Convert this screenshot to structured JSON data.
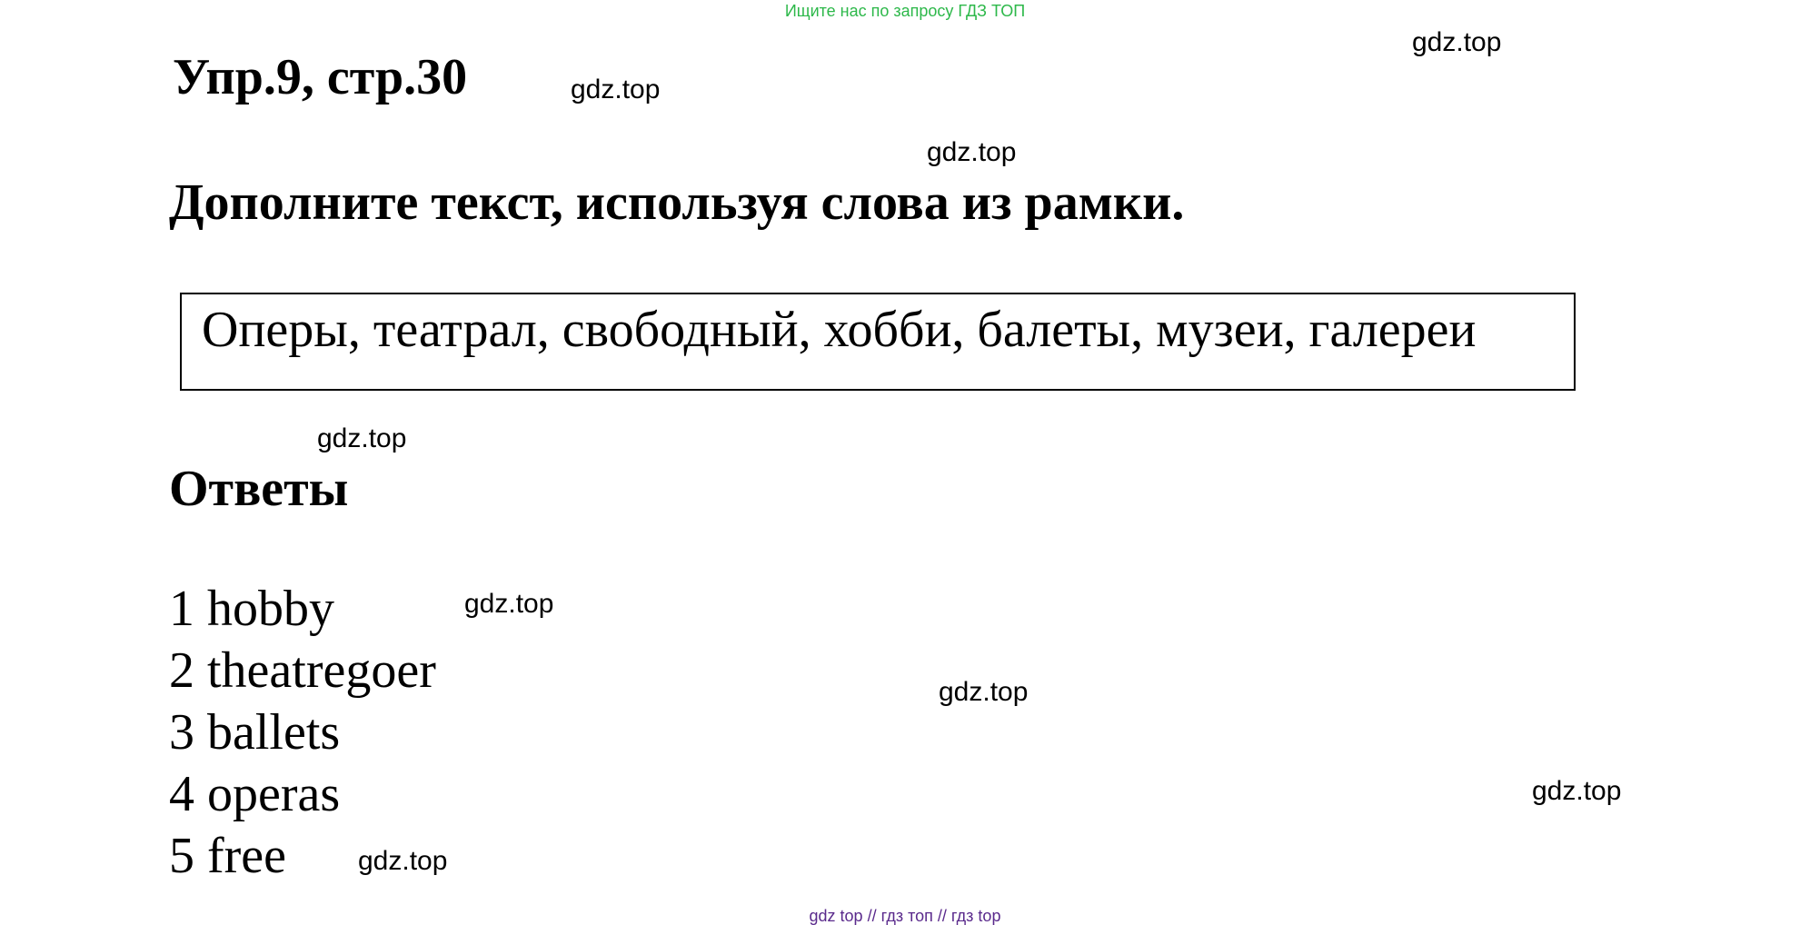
{
  "banner": {
    "text": "Ищите нас по запросу ГДЗ ТОП",
    "color": "#2db84a"
  },
  "exercise": {
    "title": "Упр.9, стр.30",
    "task": "Дополните текст, используя слова из рамки."
  },
  "word_box": {
    "text": "Оперы, театрал, свободный, хобби, балеты, музеи, галереи"
  },
  "answers": {
    "title": "Ответы",
    "items": [
      "1 hobby",
      "2 theatregoer",
      "3 ballets",
      "4 operas",
      "5 free"
    ]
  },
  "watermarks": [
    "gdz.top",
    "gdz.top",
    "gdz.top",
    "gdz.top",
    "gdz.top",
    "gdz.top",
    "gdz.top",
    "gdz.top"
  ],
  "footer": {
    "part1": "gdz top",
    "sep1": " // ",
    "part2": "гдз топ",
    "sep2": " // ",
    "part3": "гдз top",
    "color": "#5a2a8c"
  }
}
